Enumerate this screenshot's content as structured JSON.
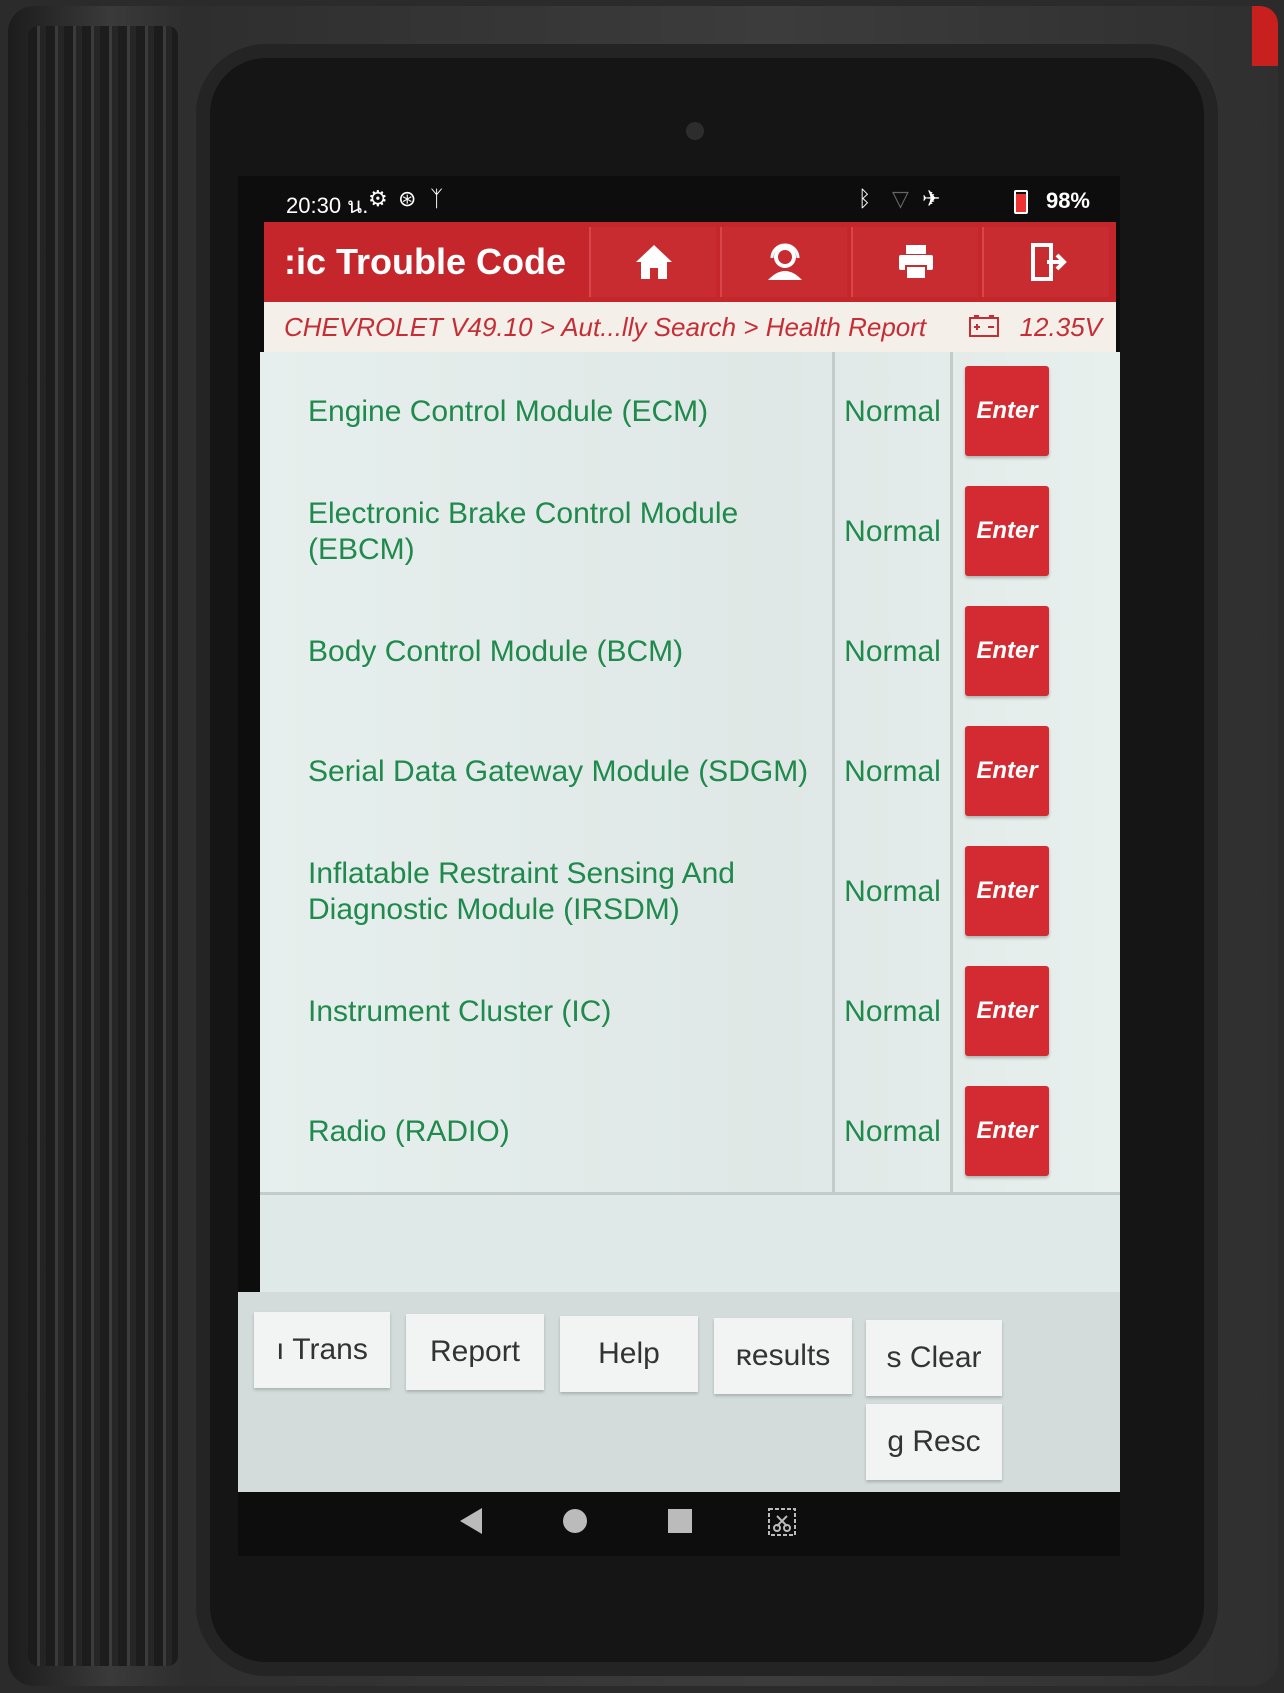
{
  "status_bar": {
    "time": "20:30 น.",
    "battery": "98%"
  },
  "header": {
    "title": ":ic Trouble Code"
  },
  "breadcrumb": {
    "path": "CHEVROLET V49.10 > Aut...lly Search > Health Report",
    "voltage": "12.35V"
  },
  "modules": [
    {
      "name": "Engine Control Module (ECM)",
      "status": "Normal",
      "action": "Enter"
    },
    {
      "name": "Electronic Brake Control Module (EBCM)",
      "status": "Normal",
      "action": "Enter"
    },
    {
      "name": "Body Control Module (BCM)",
      "status": "Normal",
      "action": "Enter"
    },
    {
      "name": "Serial Data Gateway Module (SDGM)",
      "status": "Normal",
      "action": "Enter"
    },
    {
      "name": "Inflatable Restraint Sensing And Diagnostic Module (IRSDM)",
      "status": "Normal",
      "action": "Enter"
    },
    {
      "name": "Instrument Cluster (IC)",
      "status": "Normal",
      "action": "Enter"
    },
    {
      "name": "Radio (RADIO)",
      "status": "Normal",
      "action": "Enter"
    }
  ],
  "bottom_buttons": {
    "trans": "ı   Trans",
    "report": "Report",
    "help": "Help",
    "results": "ʀesults",
    "clear": "s    Clear",
    "resc": "g    Resc"
  },
  "colors": {
    "header_red": "#c4262b",
    "enter_red": "#d42a31",
    "module_green": "#1f8a4c"
  }
}
